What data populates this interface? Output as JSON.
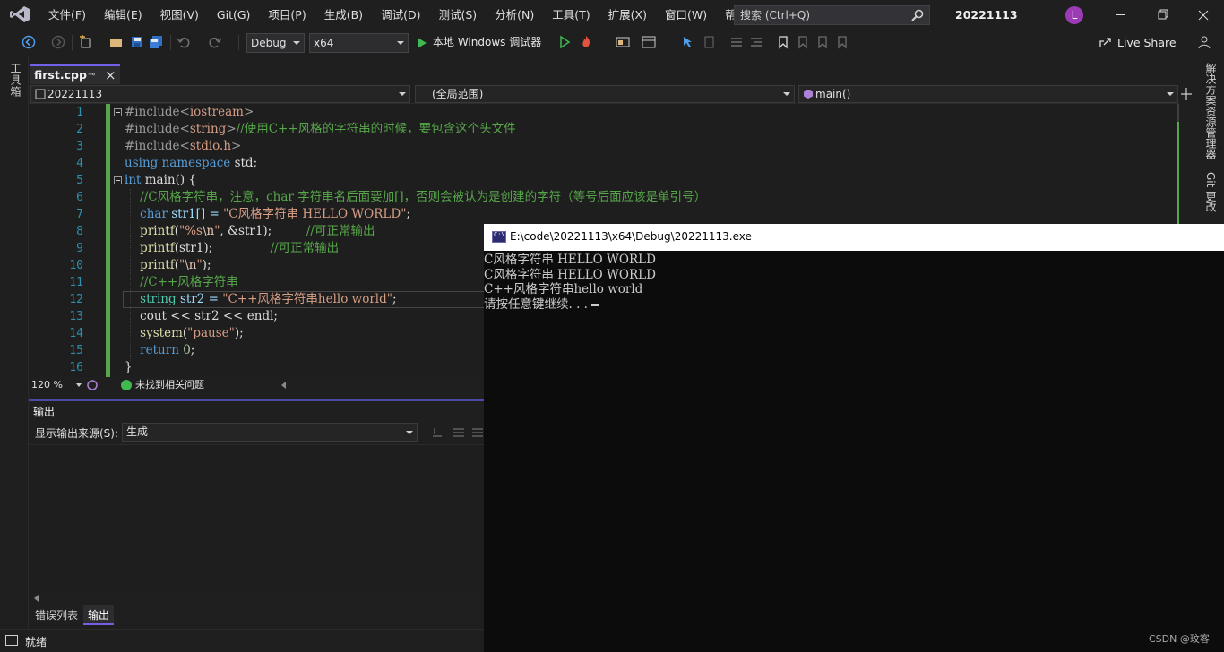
{
  "menubar": {
    "items": [
      "文件(F)",
      "编辑(E)",
      "视图(V)",
      "Git(G)",
      "项目(P)",
      "生成(B)",
      "调试(D)",
      "测试(S)",
      "分析(N)",
      "工具(T)",
      "扩展(X)",
      "窗口(W)",
      "帮助(H)"
    ],
    "search_placeholder": "搜索 (Ctrl+Q)",
    "solution_name": "20221113",
    "avatar_initial": "L"
  },
  "toolbar": {
    "configuration": "Debug",
    "platform": "x64",
    "run_label": "本地 Windows 调试器",
    "live_share": "Live Share"
  },
  "left_rail": {
    "toolbox": "工具箱"
  },
  "right_rail": {
    "solution_explorer": "解决方案资源管理器",
    "git_changes": "Git 更改"
  },
  "tab": {
    "filename": "first.cpp"
  },
  "navbar": {
    "project": "20221113",
    "scope": "(全局范围)",
    "member": "main()"
  },
  "editor": {
    "line_numbers": [
      "1",
      "2",
      "3",
      "4",
      "5",
      "6",
      "7",
      "8",
      "9",
      "10",
      "11",
      "12",
      "13",
      "14",
      "15",
      "16"
    ]
  },
  "code": {
    "l1": {
      "pp": "#include",
      "lt": "<",
      "hdr": "iostream",
      "gt": ">"
    },
    "l2": {
      "pp": "#include",
      "lt": "<",
      "hdr": "string",
      "gt": ">",
      "comment": "//使用C++风格的字符串的时候，要包含这个头文件"
    },
    "l3": {
      "pp": "#include",
      "lt": "<",
      "hdr": "stdio.h",
      "gt": ">"
    },
    "l4": {
      "kw1": "using",
      "kw2": "namespace",
      "ident": "std;"
    },
    "l5": {
      "type": "int",
      "name": "main() {"
    },
    "l6": {
      "comment": "//C风格字符串，注意，char 字符串名后面要加[]，否则会被认为是创建的字符（等号后面应该是单引号）"
    },
    "l7": {
      "type": "char",
      "rest": "str1[] = ",
      "str": "\"C风格字符串 HELLO WORLD\"",
      "end": ";"
    },
    "l8": {
      "fn": "printf",
      "open": "(",
      "str1": "\"%s",
      "esc": "\\n",
      "str2": "\"",
      "rest": ", &str1);",
      "comment": "//可正常输出"
    },
    "l9": {
      "fn": "printf",
      "rest": "(str1);",
      "comment": "//可正常输出"
    },
    "l10": {
      "fn": "printf",
      "open": "(",
      "str1": "\"",
      "esc": "\\n",
      "str2": "\"",
      "end": ");"
    },
    "l11": {
      "comment": "//C++风格字符串"
    },
    "l12": {
      "type": "string",
      "rest": "str2 = ",
      "str": "\"C++风格字符串hello world\"",
      "end": ";"
    },
    "l13": {
      "rest": "cout << str2 << endl;"
    },
    "l14": {
      "fn": "system",
      "open": "(",
      "str": "\"pause\"",
      "end": ");"
    },
    "l15": {
      "kw": "return",
      "num": "0",
      "end": ";"
    },
    "l16": {
      "brace": "}"
    }
  },
  "editor_status": {
    "zoom": "120 %",
    "issues": "未找到相关问题"
  },
  "output": {
    "title": "输出",
    "source_label": "显示输出来源(S):",
    "source_value": "生成"
  },
  "bottom_tabs": {
    "errors": "错误列表",
    "output": "输出"
  },
  "statusbar": {
    "text": "就绪"
  },
  "console": {
    "title": "E:\\code\\20221113\\x64\\Debug\\20221113.exe",
    "lines": [
      "C风格字符串 HELLO WORLD",
      "C风格字符串 HELLO WORLD",
      "C++风格字符串hello world",
      "请按任意键继续. . ."
    ],
    "watermark": "CSDN @玟客"
  },
  "colors": {
    "accent": "#7160e8",
    "keyword": "#569cd6",
    "type": "#4ec9b0",
    "string": "#d69d85",
    "comment": "#57a64a",
    "line_number": "#2b91af"
  }
}
